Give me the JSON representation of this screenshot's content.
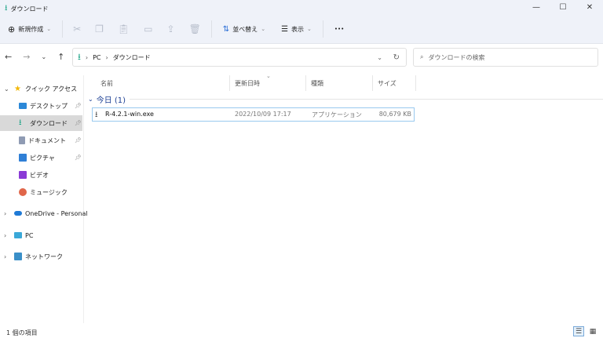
{
  "window": {
    "title": "ダウンロード",
    "minimize": "—",
    "maximize": "☐",
    "close": "✕"
  },
  "toolbar": {
    "new": "新規作成",
    "sort": "並べ替え",
    "view": "表示",
    "more": "•••"
  },
  "address": {
    "crumbs": [
      "PC",
      "ダウンロード"
    ],
    "search_placeholder": "ダウンロードの検索"
  },
  "sidebar": {
    "quick_access": "クイック アクセス",
    "items": [
      {
        "label": "デスクトップ",
        "pinned": true,
        "color": "#2b88d8"
      },
      {
        "label": "ダウンロード",
        "pinned": true,
        "selected": true,
        "color": "#1aa385"
      },
      {
        "label": "ドキュメント",
        "pinned": true,
        "color": "#8f9bb3"
      },
      {
        "label": "ピクチャ",
        "pinned": true,
        "color": "#2f7fd6"
      },
      {
        "label": "ビデオ",
        "pinned": false,
        "color": "#8a3ad6"
      },
      {
        "label": "ミュージック",
        "pinned": false,
        "color": "#e0664a"
      }
    ],
    "onedrive": "OneDrive - Personal",
    "pc": "PC",
    "network": "ネットワーク"
  },
  "columns": {
    "name": "名前",
    "date": "更新日時",
    "type": "種類",
    "size": "サイズ"
  },
  "group": {
    "label": "今日 (1)"
  },
  "files": [
    {
      "name": "R-4.2.1-win.exe",
      "date": "2022/10/09 17:17",
      "type": "アプリケーション",
      "size": "80,679 KB"
    }
  ],
  "status": {
    "count": "1 個の項目"
  }
}
